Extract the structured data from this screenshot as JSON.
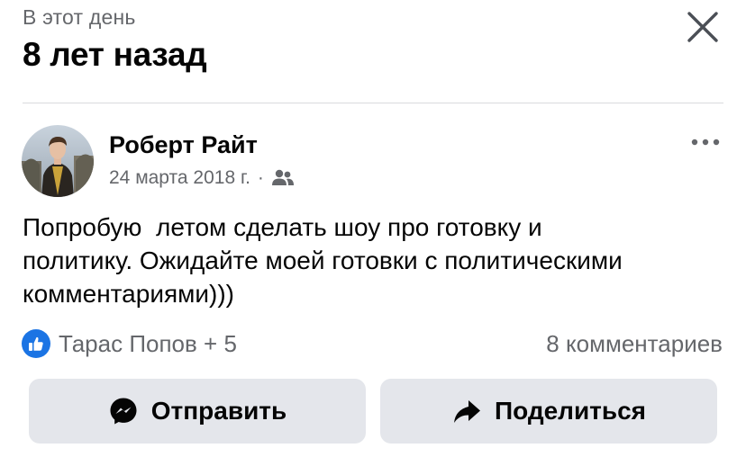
{
  "header": {
    "kicker": "В этот день",
    "title": "8 лет назад",
    "close_icon": "close-icon"
  },
  "post": {
    "author": "Роберт Райт",
    "date": "24 марта 2018 г.",
    "separator": "·",
    "audience_icon": "friends-icon",
    "text": "Попробую  летом сделать шоу про готовку и\nполитику. Ожидайте моей готовки с политическими\nкомментариями)))",
    "more_icon": "more-dots-icon"
  },
  "engagement": {
    "reaction_icon": "like-icon",
    "reactors": "Тарас Попов + 5",
    "comments": "8 комментариев"
  },
  "actions": {
    "send_label": "Отправить",
    "send_icon": "messenger-icon",
    "share_label": "Поделиться",
    "share_icon": "share-arrow-icon"
  },
  "colors": {
    "accent": "#1b74e4",
    "secondary_text": "#65676b",
    "button_bg": "#e4e6eb",
    "primary_text": "#050505"
  }
}
